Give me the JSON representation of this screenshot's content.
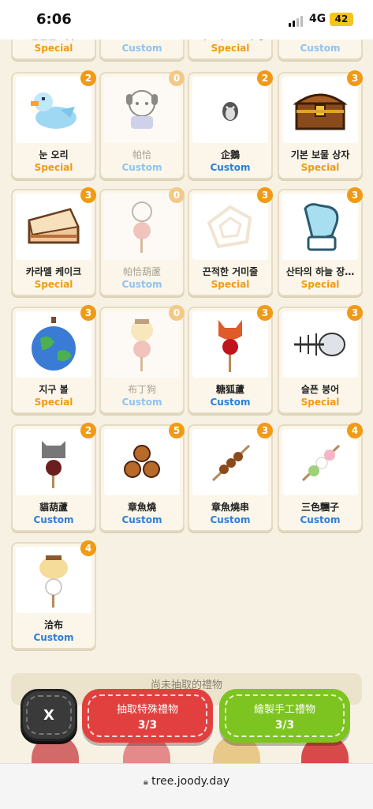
{
  "status": {
    "time": "6:06",
    "network": "4G",
    "battery": "42"
  },
  "top_partial": [
    {
      "name": "집현전 계우",
      "type": "Special"
    },
    {
      "name": "…",
      "type": "Custom"
    },
    {
      "name": "크리스마스 트리 장식 별",
      "type": "Special"
    },
    {
      "name": "…",
      "type": "Custom"
    }
  ],
  "items": [
    {
      "name": "눈 오리",
      "type": "Special",
      "count": "2",
      "dim": false,
      "icon": "snow-duck-icon"
    },
    {
      "name": "帕恰",
      "type": "Custom",
      "count": "0",
      "dim": true,
      "icon": "pochacco-icon"
    },
    {
      "name": "企鵝",
      "type": "Custom",
      "count": "2",
      "dim": false,
      "icon": "penguin-icon"
    },
    {
      "name": "기본 보물 상자",
      "type": "Special",
      "count": "3",
      "dim": false,
      "icon": "treasure-chest-icon"
    },
    {
      "name": "카라멜 케이크",
      "type": "Special",
      "count": "3",
      "dim": false,
      "icon": "caramel-cake-icon"
    },
    {
      "name": "帕恰葫蘆",
      "type": "Custom",
      "count": "0",
      "dim": true,
      "icon": "pochacco-candy-icon"
    },
    {
      "name": "끈적한 거미줄",
      "type": "Special",
      "count": "3",
      "dim": false,
      "icon": "spider-web-icon"
    },
    {
      "name": "산타의 하늘 장…",
      "type": "Special",
      "count": "3",
      "dim": false,
      "icon": "mitten-icon"
    },
    {
      "name": "지구 볼",
      "type": "Special",
      "count": "3",
      "dim": false,
      "icon": "earth-ball-icon"
    },
    {
      "name": "布丁狗",
      "type": "Custom",
      "count": "0",
      "dim": true,
      "icon": "pompompurin-candy-icon"
    },
    {
      "name": "糖狐蘆",
      "type": "Custom",
      "count": "3",
      "dim": false,
      "icon": "fox-candy-icon"
    },
    {
      "name": "슬픈 붕어",
      "type": "Special",
      "count": "3",
      "dim": false,
      "icon": "fish-bone-icon"
    },
    {
      "name": "貓葫蘆",
      "type": "Custom",
      "count": "2",
      "dim": false,
      "icon": "cat-candy-icon"
    },
    {
      "name": "章魚燒",
      "type": "Custom",
      "count": "5",
      "dim": false,
      "icon": "takoyaki-icon"
    },
    {
      "name": "章魚燒串",
      "type": "Custom",
      "count": "3",
      "dim": false,
      "icon": "takoyaki-skewer-icon"
    },
    {
      "name": "三色糰子",
      "type": "Custom",
      "count": "4",
      "dim": false,
      "icon": "dango-icon"
    },
    {
      "name": "洽布",
      "type": "Custom",
      "count": "4",
      "dim": false,
      "icon": "purin-skewer-icon"
    }
  ],
  "pending_label": "尚未抽取的禮物",
  "buttons": {
    "close": "X",
    "special": {
      "label": "抽取特殊禮物",
      "count": "3/3"
    },
    "handmade": {
      "label": "繪製手工禮物",
      "count": "3/3"
    }
  },
  "url": "tree.joody.day"
}
